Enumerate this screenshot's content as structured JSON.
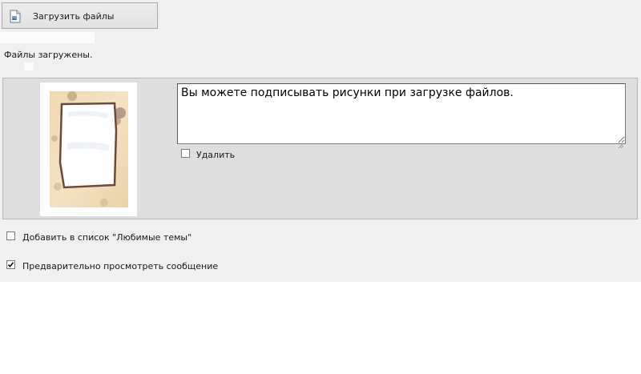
{
  "toolbar": {
    "upload_label": "Загрузить файлы",
    "upload_icon": "document-icon"
  },
  "status": {
    "message": "Файлы загружены."
  },
  "attachment": {
    "thumbnail": "picture-frame-image",
    "caption_value": "Вы можете подписывать рисунки при загрузке файлов.",
    "delete_label": "Удалить",
    "delete_checked": false
  },
  "options": {
    "favorites_label": "Добавить в список \"Любимые темы\"",
    "favorites_checked": false,
    "preview_label": "Предварительно просмотреть сообщение",
    "preview_checked": true
  },
  "colors": {
    "page_background": "#f0f0f0",
    "panel_background": "#dedede",
    "panel_border": "#b6b6b6"
  }
}
